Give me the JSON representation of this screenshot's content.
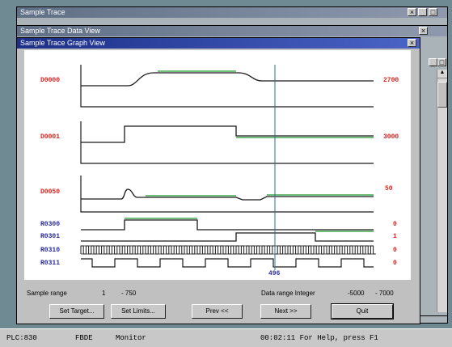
{
  "windows": {
    "outer_title": "Sample Trace",
    "middle_title": "Sample Trace Data View",
    "inner_title": "Sample Trace Graph View"
  },
  "channels": [
    {
      "name": "D0000",
      "type": "analog",
      "max_label": "2700"
    },
    {
      "name": "D0001",
      "type": "analog",
      "max_label": "3000"
    },
    {
      "name": "D0050",
      "type": "analog",
      "max_label": "50"
    },
    {
      "name": "R0300",
      "type": "bit",
      "state": "0"
    },
    {
      "name": "R0301",
      "type": "bit",
      "state": "1"
    },
    {
      "name": "R0310",
      "type": "bit",
      "state": "0"
    },
    {
      "name": "R0311",
      "type": "bit",
      "state": "0"
    }
  ],
  "cursor": {
    "sample": "496"
  },
  "info": {
    "sample_range_label": "Sample range",
    "sample_range_from": "1",
    "sample_range_to": "- 750",
    "data_range_label": "Data range  Integer",
    "data_range_min": "-5000",
    "data_range_max": "- 7000"
  },
  "buttons": {
    "set_target": "Set Target...",
    "set_limits": "Set Limits...",
    "prev": "Prev <<",
    "next": "Next >>",
    "quit": "Quit"
  },
  "status": {
    "plc": "PLC:830",
    "mode1": "FBDE",
    "mode2": "Monitor",
    "message": "00:02:11 For Help, press F1"
  },
  "colors": {
    "channel_name_analog": "#e0201c",
    "channel_name_bit": "#2a2aa0",
    "trace": "#1a1a1a",
    "trace_highlight": "#1c9a2c",
    "cursor": "#2e6e96",
    "title_active": "#1c2f88"
  }
}
